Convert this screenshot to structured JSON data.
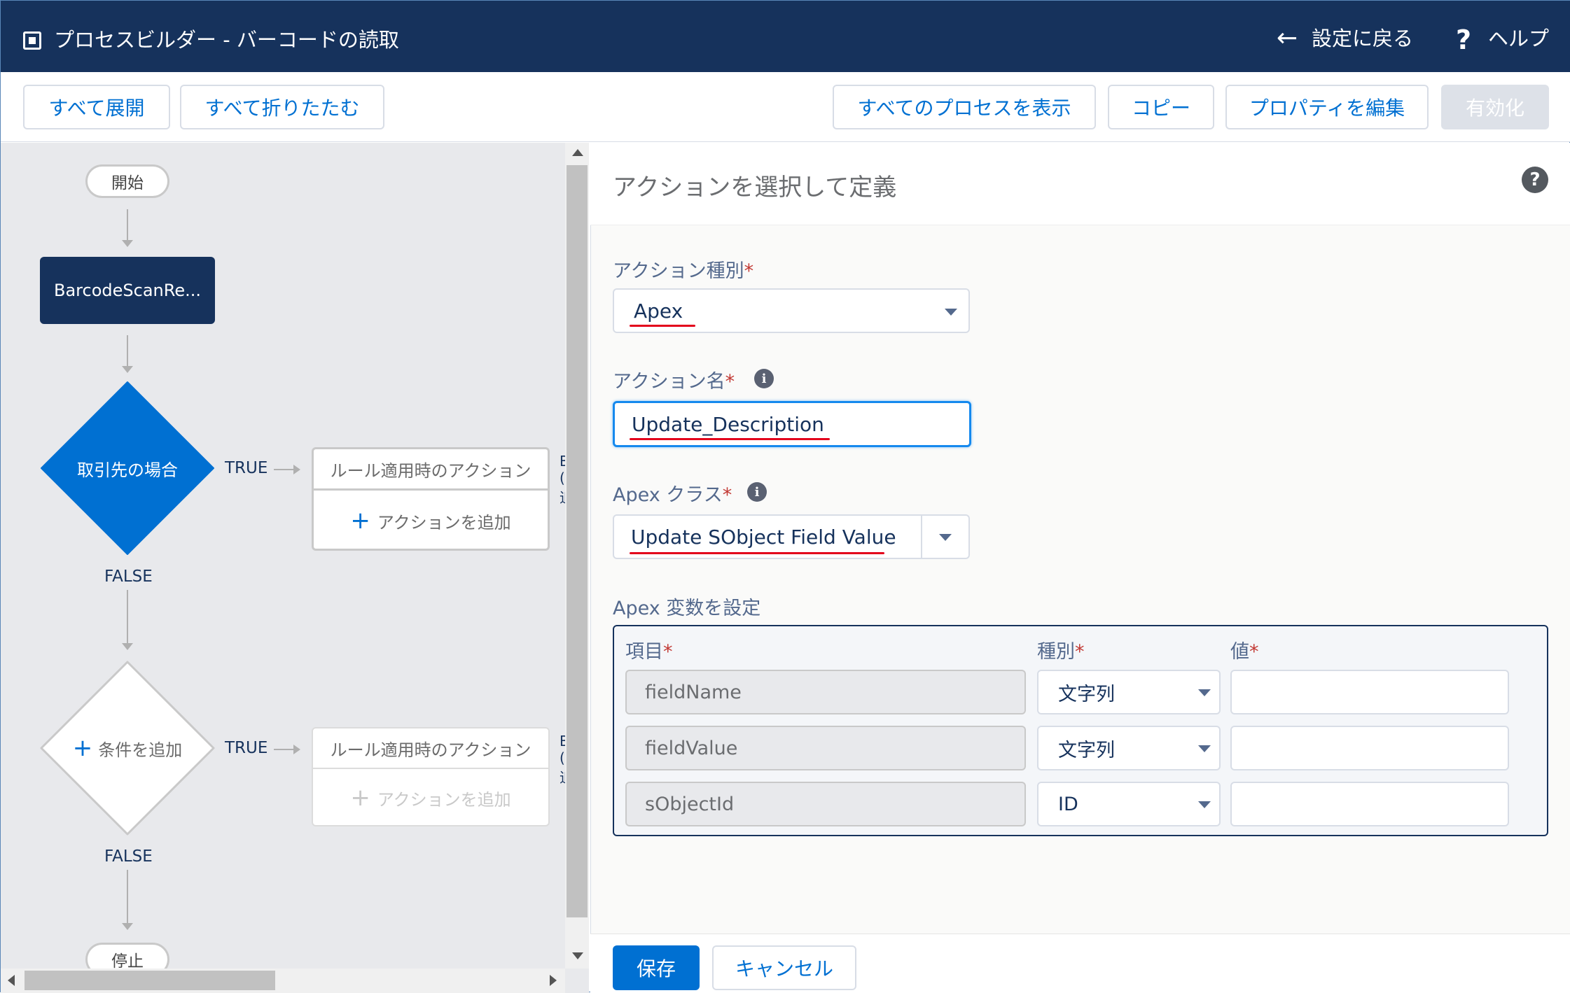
{
  "header": {
    "title": "プロセスビルダー - バーコードの読取",
    "back_icon": "←",
    "back_label": "設定に戻る",
    "help_icon": "?",
    "help_label": "ヘルプ"
  },
  "toolbar": {
    "expand_all": "すべて展開",
    "collapse_all": "すべて折りたたむ",
    "view_all": "すべてのプロセスを表示",
    "copy": "コピー",
    "edit_props": "プロパティを編集",
    "activate": "有効化"
  },
  "canvas": {
    "start": "開始",
    "object_node": "BarcodeScanRe...",
    "criteria1": "取引先の場合",
    "criteria2": "条件を追加",
    "plus": "+",
    "true_label": "TRUE",
    "false_label": "FALSE",
    "rule_actions": "ルール適用時のアクション",
    "add_action": "アクションを追加",
    "stop": "停止",
    "truncated_1": "B",
    "truncated_2": "(",
    "truncated_3": "追"
  },
  "panel": {
    "title": "アクションを選択して定義",
    "help_icon": "?",
    "action_type_label": "アクション種別",
    "action_type_value": "Apex",
    "action_name_label": "アクション名",
    "action_name_value": "Update_Description",
    "apex_class_label": "Apex クラス",
    "apex_class_value": "Update SObject Field Value",
    "vars_title": "Apex 変数を設定",
    "required_mark": "*",
    "info_icon": "i",
    "col_field": "項目",
    "col_type": "種別",
    "col_value": "値",
    "rows": [
      {
        "field": "fieldName",
        "type": "文字列"
      },
      {
        "field": "fieldValue",
        "type": "文字列"
      },
      {
        "field": "sObjectId",
        "type": "ID"
      }
    ]
  },
  "footer": {
    "save": "保存",
    "cancel": "キャンセル"
  },
  "colors": {
    "header_bg": "#16325c",
    "brand_blue": "#0070d2",
    "focus_blue": "#1589ee",
    "annotation_red": "#e3001b"
  }
}
